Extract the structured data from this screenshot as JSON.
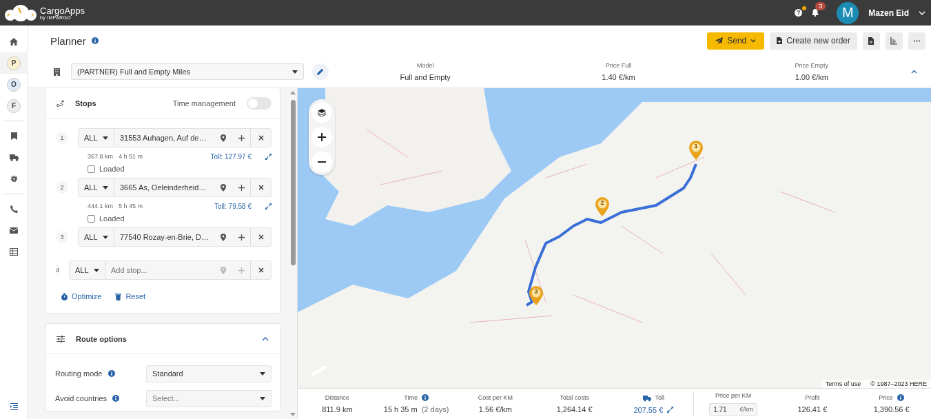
{
  "app": {
    "name": "CargoApps",
    "tagline": "by IMPARGO",
    "help_icon": "?",
    "help_dot": true,
    "notifications": "3",
    "user_initial": "M",
    "user_name": "Mazen Eid"
  },
  "sidebar": {
    "items": [
      {
        "kind": "icon",
        "selected": false
      },
      {
        "kind": "letter",
        "label": "P",
        "color": "#fbf1cf",
        "selected": true
      },
      {
        "kind": "letter",
        "label": "O",
        "color": "#dfeaf8",
        "selected": false
      },
      {
        "kind": "letter",
        "label": "F",
        "color": "#eeeeee",
        "selected": false
      },
      {
        "kind": "divider"
      },
      {
        "kind": "icon",
        "selected": false
      },
      {
        "kind": "icon",
        "selected": false
      },
      {
        "kind": "icon",
        "selected": false
      },
      {
        "kind": "divider"
      },
      {
        "kind": "icon",
        "selected": false
      },
      {
        "kind": "icon",
        "selected": false
      },
      {
        "kind": "icon",
        "selected": false
      }
    ]
  },
  "page": {
    "title": "Planner",
    "actions": [
      {
        "kind": "primary",
        "label": "Send"
      },
      {
        "kind": "secondary",
        "label": "Create new order"
      },
      {
        "kind": "icon"
      },
      {
        "kind": "icon"
      },
      {
        "kind": "icon"
      }
    ]
  },
  "model_bar": {
    "profile": "(PARTNER) Full and Empty Miles",
    "columns": [
      {
        "label": "Model",
        "value": "Full and Empty"
      },
      {
        "label": "Price Full",
        "value": "1.40 €/km"
      },
      {
        "label": "Price Empty",
        "value": "1.00 €/km"
      }
    ],
    "expanded": true
  },
  "stops": {
    "title": "Stops",
    "time_management": {
      "label": "Time management",
      "on": false
    },
    "items": [
      {
        "number": "1",
        "mode": "ALL",
        "address": "31553 Auhagen, Auf de…",
        "empty": false
      },
      {
        "number": "2",
        "mode": "ALL",
        "address": "3665 As, Oeleinderheid…",
        "empty": false
      },
      {
        "number": "3",
        "mode": "ALL",
        "address": "77540 Rozay-en-Brie, D…",
        "empty": false
      },
      {
        "number": "4",
        "mode": "ALL",
        "placeholder": "Add stop...",
        "empty": true
      }
    ],
    "legs": [
      {
        "distance": "367.8 km",
        "duration": "4 h 51 m",
        "toll": "Toll: 127.97 €",
        "loaded_label": "Loaded",
        "loaded": false
      },
      {
        "distance": "444.1 km",
        "duration": "5 h 45 m",
        "toll": "Toll: 79.58 €",
        "loaded_label": "Loaded",
        "loaded": false
      }
    ],
    "links": [
      "Optimize",
      "Reset"
    ]
  },
  "route_options": {
    "title": "Route options",
    "expanded": true,
    "fields": [
      {
        "label": "Routing mode",
        "value": "Standard"
      },
      {
        "label": "Avoid countries",
        "placeholder": "Select..."
      }
    ]
  },
  "map": {
    "markers": [
      "1",
      "2",
      "3"
    ],
    "attribution": [
      "Terms of use",
      "© 1987–2023 HERE"
    ]
  },
  "stats": {
    "items": [
      {
        "kind": "plain",
        "label": "Distance",
        "value": "811.9 km"
      },
      {
        "kind": "info",
        "label": "Time",
        "value": "15 h 35 m",
        "extra": "(2 days)"
      },
      {
        "kind": "plain",
        "label": "Cost per KM",
        "value": "1.56 €/km"
      },
      {
        "kind": "plain",
        "label": "Total costs",
        "value": "1,264.14 €"
      },
      {
        "kind": "toll",
        "label": "Toll",
        "value": "207.55 €"
      },
      {
        "kind": "input",
        "label": "Price per KM",
        "value": "1.71",
        "unit": "€/km"
      },
      {
        "kind": "plain",
        "label": "Profit",
        "value": "126.41 €"
      },
      {
        "kind": "info",
        "label": "Price",
        "value": "1,390.56 €"
      }
    ]
  }
}
